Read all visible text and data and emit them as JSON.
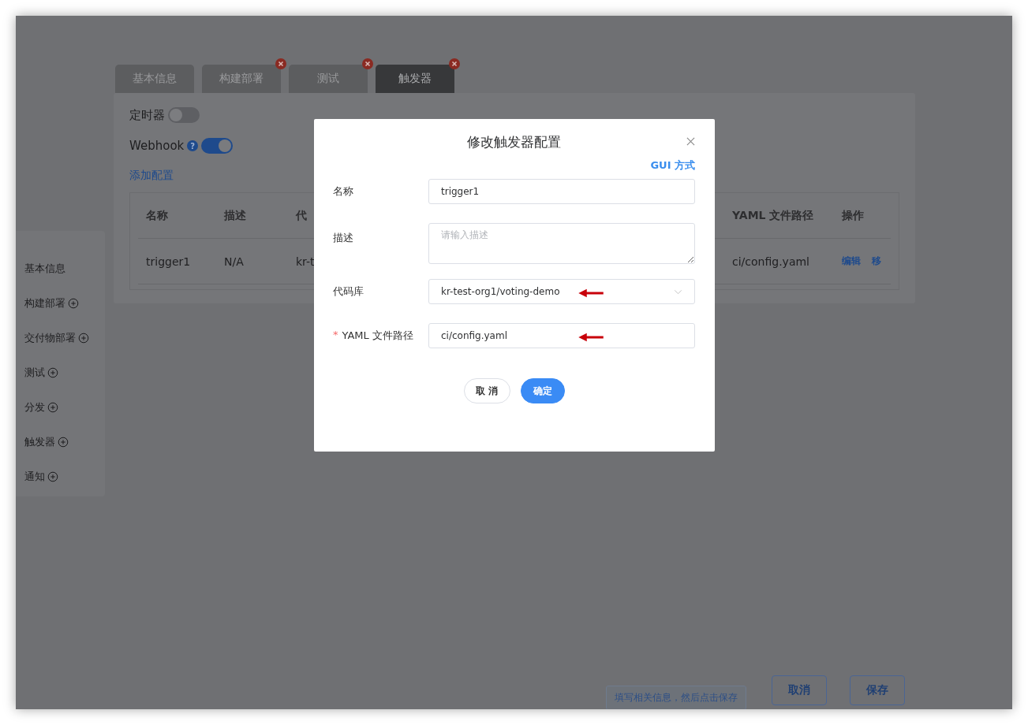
{
  "tabs": [
    {
      "label": "基本信息",
      "selected": false,
      "closable": false
    },
    {
      "label": "构建部署",
      "selected": false,
      "closable": true
    },
    {
      "label": "测试",
      "selected": false,
      "closable": true
    },
    {
      "label": "触发器",
      "selected": true,
      "closable": true
    }
  ],
  "triggers": [
    {
      "label": "定时器",
      "on": false
    },
    {
      "label": "Webhook",
      "on": true,
      "help": "?"
    }
  ],
  "add_link": "添加配置",
  "table": {
    "columns": [
      "名称",
      "描述",
      "代",
      "YAML 文件路径",
      "操作"
    ],
    "rows": [
      {
        "name": "trigger1",
        "desc": "N/A",
        "repo": "kr-t",
        "path": "ci/config.yaml",
        "actions": [
          "编辑",
          "移"
        ]
      }
    ]
  },
  "sidebar": {
    "items": [
      {
        "label": "基本信息",
        "addable": false
      },
      {
        "label": "构建部署",
        "addable": true
      },
      {
        "label": "交付物部署",
        "addable": true
      },
      {
        "label": "测试",
        "addable": true
      },
      {
        "label": "分发",
        "addable": true
      },
      {
        "label": "触发器",
        "addable": true
      },
      {
        "label": "通知",
        "addable": true
      }
    ]
  },
  "footer": {
    "hint": "填写相关信息，然后点击保存",
    "buttons": [
      "取消",
      "保存"
    ]
  },
  "dialog": {
    "title": "修改触发器配置",
    "mode_link": "GUI 方式",
    "fields": [
      {
        "kind": "input",
        "label": "名称",
        "value": "trigger1",
        "required": false,
        "marked": false
      },
      {
        "kind": "textarea",
        "label": "描述",
        "placeholder": "请输入描述",
        "required": false,
        "marked": false
      },
      {
        "kind": "select",
        "label": "代码库",
        "value": "kr-test-org1/voting-demo",
        "required": false,
        "marked": true
      },
      {
        "kind": "input",
        "label": "YAML 文件路径",
        "value": "ci/config.yaml",
        "required": true,
        "marked": true
      }
    ],
    "required_mark": "*",
    "buttons": [
      {
        "label": "取 消",
        "primary": false
      },
      {
        "label": "确定",
        "primary": true
      }
    ]
  }
}
